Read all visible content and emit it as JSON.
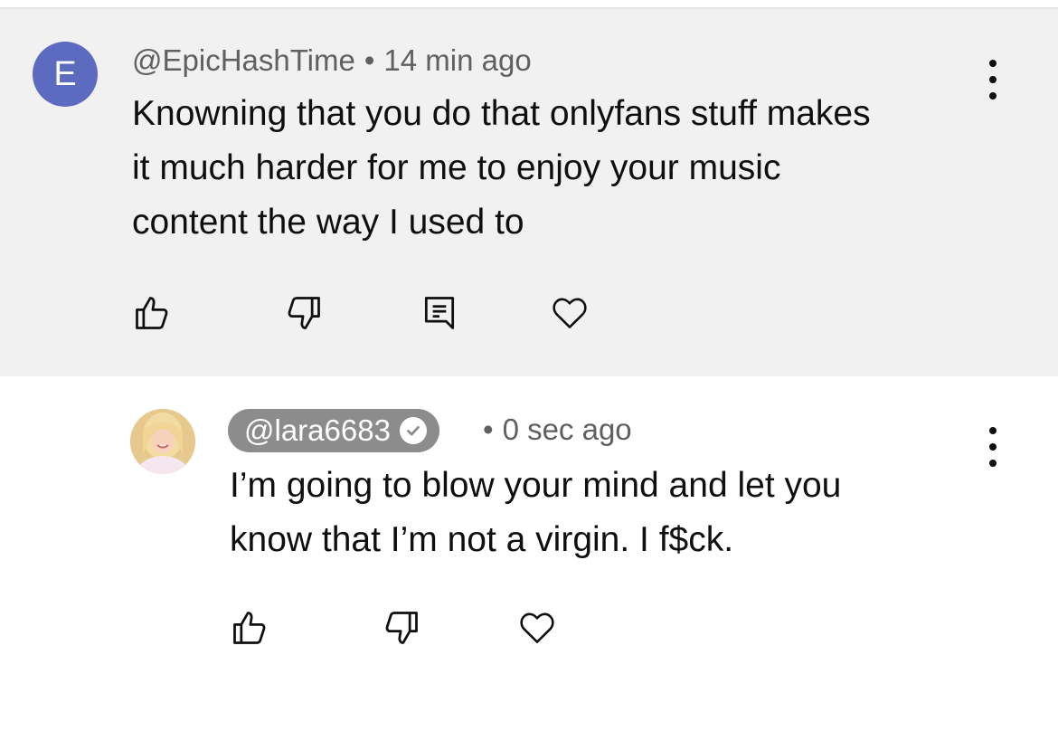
{
  "comment": {
    "avatar_letter": "E",
    "username": "@EpicHashTime",
    "separator": "•",
    "time_ago": "14 min ago",
    "lines": [
      "Knowning that you do that onlyfans stuff makes",
      "it much harder for me to enjoy your music",
      "content the way I used to"
    ],
    "actions": [
      "thumbs-up-icon",
      "thumbs-down-icon",
      "reply-icon",
      "heart-icon"
    ]
  },
  "reply": {
    "username": "@lara6683",
    "verified": true,
    "separator": "•",
    "time_ago": "0 sec ago",
    "lines": [
      "I’m going to blow your mind and let you",
      "know that I’m not a virgin. I f$ck."
    ],
    "actions": [
      "thumbs-up-icon",
      "thumbs-down-icon",
      "heart-icon"
    ]
  },
  "colors": {
    "highlight_bg": "#f1f1f1",
    "avatar_bg": "#5c6bc0",
    "owner_badge_bg": "#8c8c8c",
    "meta_text": "#606060"
  }
}
